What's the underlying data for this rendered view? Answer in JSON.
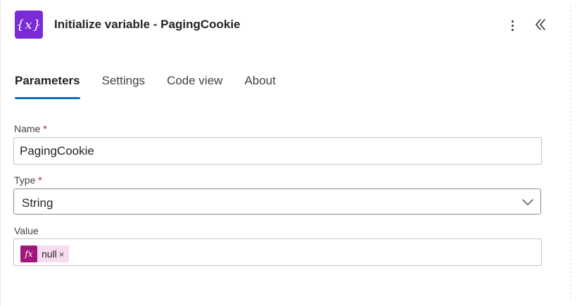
{
  "header": {
    "title": "Initialize variable - PagingCookie",
    "app_icon_glyph": "{x}",
    "app_icon_color": "#7a2bd6",
    "more_icon": "more-vertical-icon",
    "collapse_icon": "double-chevron-left-icon"
  },
  "tabs": [
    {
      "label": "Parameters",
      "active": true
    },
    {
      "label": "Settings",
      "active": false
    },
    {
      "label": "Code view",
      "active": false
    },
    {
      "label": "About",
      "active": false
    }
  ],
  "accent_color": "#0f6cbd",
  "form": {
    "name": {
      "label": "Name",
      "required_mark": "*",
      "value": "PagingCookie"
    },
    "type": {
      "label": "Type",
      "required_mark": "*",
      "value": "String"
    },
    "value": {
      "label": "Value",
      "token": {
        "icon_glyph": "fx",
        "text": "null",
        "close": "×",
        "color": "#a2177d"
      }
    }
  }
}
